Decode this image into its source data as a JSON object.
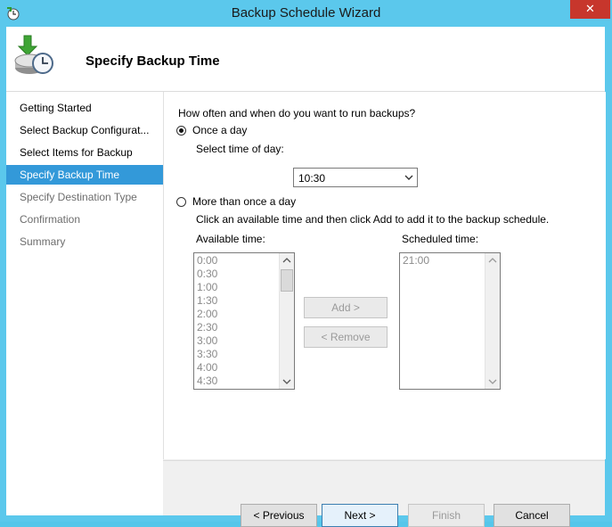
{
  "window": {
    "title": "Backup Schedule Wizard",
    "close_glyph": "✕"
  },
  "header": {
    "title": "Specify Backup Time",
    "icon": "backup-clock-icon"
  },
  "nav": {
    "items": [
      {
        "label": "Getting Started",
        "state": "done"
      },
      {
        "label": "Select Backup Configurat...",
        "state": "done"
      },
      {
        "label": "Select Items for Backup",
        "state": "done"
      },
      {
        "label": "Specify Backup Time",
        "state": "active"
      },
      {
        "label": "Specify Destination Type",
        "state": "pending"
      },
      {
        "label": "Confirmation",
        "state": "pending"
      },
      {
        "label": "Summary",
        "state": "pending"
      }
    ]
  },
  "form": {
    "question": "How often and when do you want to run backups?",
    "once_label": "Once a day",
    "time_label": "Select time of day:",
    "time_value": "10:30",
    "more_label": "More than once a day",
    "instruction": "Click an available time and then click Add to add it to the backup schedule.",
    "available_label": "Available time:",
    "scheduled_label": "Scheduled time:",
    "available_times": [
      "0:00",
      "0:30",
      "1:00",
      "1:30",
      "2:00",
      "2:30",
      "3:00",
      "3:30",
      "4:00",
      "4:30"
    ],
    "scheduled_times": [
      "21:00"
    ],
    "add_label": "Add >",
    "remove_label": "< Remove",
    "selected_option": "once"
  },
  "footer": {
    "previous_label": "< Previous",
    "next_label": "Next >",
    "finish_label": "Finish",
    "cancel_label": "Cancel"
  },
  "colors": {
    "accent": "#3399d9",
    "titlebar": "#5bc8ec",
    "close": "#c7362c"
  }
}
